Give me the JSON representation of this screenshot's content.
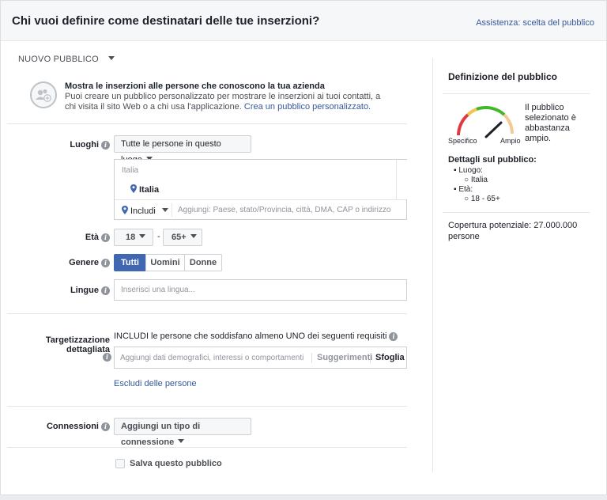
{
  "header": {
    "title": "Chi vuoi definire come destinatari delle tue inserzioni?",
    "help_link": "Assistenza: scelta del pubblico"
  },
  "new_audience": {
    "label": "NUOVO PUBBLICO"
  },
  "custom_audience": {
    "title": "Mostra le inserzioni alle persone che conoscono la tua azienda",
    "description": "Puoi creare un pubblico personalizzato per mostrare le inserzioni ai tuoi contatti, a chi visita il sito Web o a chi usa l'applicazione.",
    "link": "Crea un pubblico personalizzato."
  },
  "locations": {
    "label": "Luoghi",
    "dropdown": "Tutte le persone in questo luogo",
    "country_header": "Italia",
    "selected_location": "Italia",
    "include_label": "Includi",
    "placeholder": "Aggiungi: Paese, stato/Provincia, città, DMA, CAP o indirizzo"
  },
  "age": {
    "label": "Età",
    "min": "18",
    "separator": "-",
    "max": "65+"
  },
  "gender": {
    "label": "Genere",
    "options": [
      "Tutti",
      "Uomini",
      "Donne"
    ],
    "selected": "Tutti"
  },
  "languages": {
    "label": "Lingue",
    "placeholder": "Inserisci una lingua..."
  },
  "detailed_targeting": {
    "label": "Targetizzazione dettagliata",
    "include_text": "INCLUDI le persone che soddisfano almeno UNO dei seguenti requisiti",
    "placeholder": "Aggiungi dati demografici, interessi o comportamenti",
    "suggestions": "Suggerimenti",
    "browse": "Sfoglia",
    "exclude_link": "Escludi delle persone"
  },
  "connections": {
    "label": "Connessioni",
    "dropdown": "Aggiungi un tipo di connessione"
  },
  "save_audience": {
    "label": "Salva questo pubblico",
    "checked": false
  },
  "audience_definition": {
    "title": "Definizione del pubblico",
    "gauge_left": "Specifico",
    "gauge_right": "Ampio",
    "gauge_text": "Il pubblico selezionato è abbastanza ampio.",
    "details_title": "Dettagli sul pubblico:",
    "location_label": "Luogo:",
    "location_value": "Italia",
    "age_label": "Età:",
    "age_value": "18 - 65+",
    "reach": "Copertura potenziale: 27.000.000 persone"
  },
  "colors": {
    "link": "#365899",
    "selected_button": "#4267b2",
    "gauge_red": "#e0393e",
    "gauge_yellow": "#f0c54a",
    "gauge_green": "#42b72a"
  }
}
